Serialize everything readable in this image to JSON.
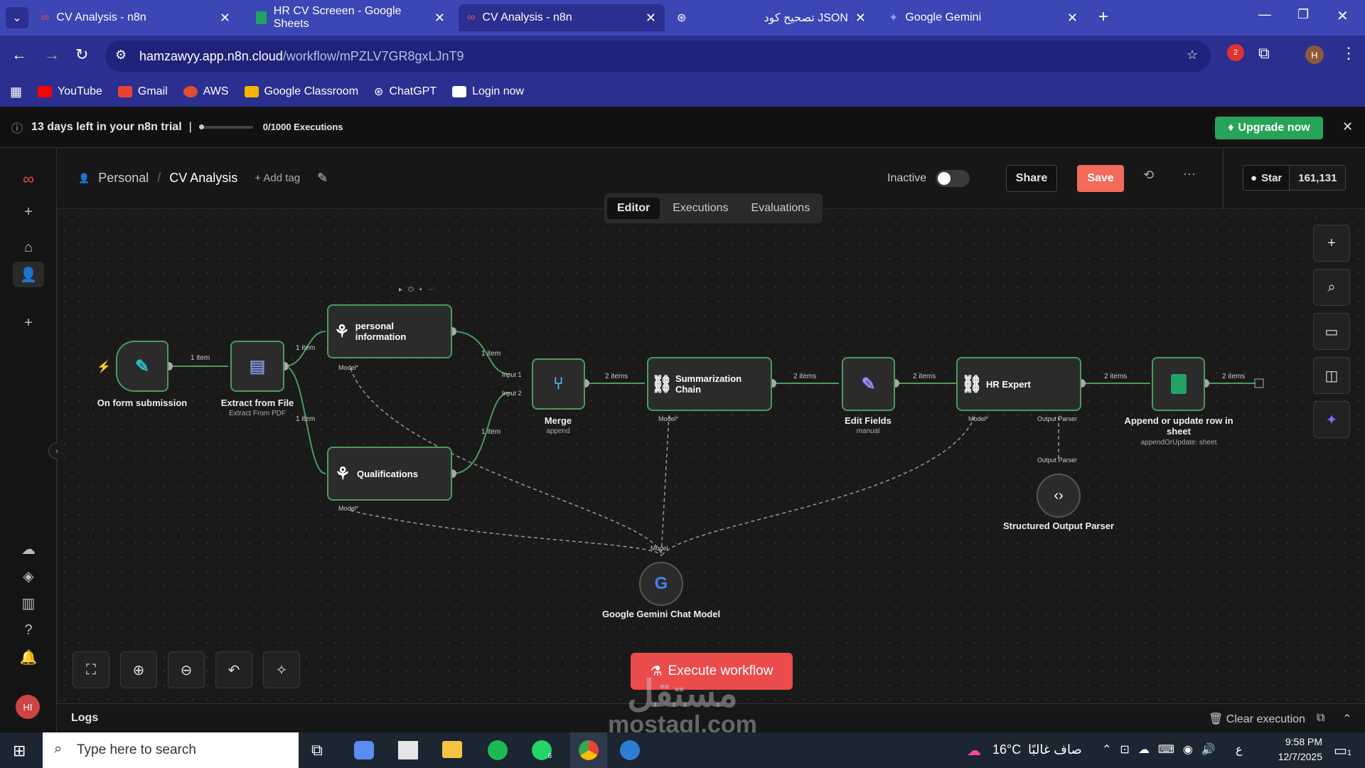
{
  "browser": {
    "tabs": [
      {
        "title": "CV Analysis - n8n"
      },
      {
        "title": "HR CV Screeen - Google Sheets"
      },
      {
        "title": "CV Analysis - n8n"
      },
      {
        "title": "تصحيح كود JSON"
      },
      {
        "title": "Google Gemini"
      }
    ],
    "url_host": "hamzawyy.app.n8n.cloud",
    "url_path": "/workflow/mPZLV7GR8gxLJnT9",
    "bookmarks": [
      "YouTube",
      "Gmail",
      "AWS",
      "Google Classroom",
      "ChatGPT",
      "Login now"
    ],
    "profile_initial": "H",
    "ext_badge": "2"
  },
  "trial": {
    "text": "13 days left in your n8n trial",
    "executions": "0/1000 Executions",
    "upgrade": "Upgrade now"
  },
  "header": {
    "breadcrumb_project": "Personal",
    "breadcrumb_sep": "/",
    "workflow_name": "CV Analysis",
    "add_tag": "+ Add tag",
    "status_label": "Inactive",
    "share": "Share",
    "save": "Save",
    "star": "Star",
    "star_count": "161,131",
    "tabs": [
      "Editor",
      "Executions",
      "Evaluations"
    ]
  },
  "nodes": {
    "form": {
      "label": "On form submission"
    },
    "extract": {
      "label": "Extract from File",
      "sub": "Extract From PDF"
    },
    "personal": {
      "label": "personal information"
    },
    "qual": {
      "label": "Qualifications"
    },
    "merge": {
      "label": "Merge",
      "sub": "append"
    },
    "summ": {
      "label": "Summarization Chain"
    },
    "edit": {
      "label": "Edit Fields",
      "sub": "manual"
    },
    "hr": {
      "label": "HR Expert"
    },
    "sheet": {
      "label": "Append or update row in sheet",
      "sub": "appendOrUpdate: sheet"
    },
    "parser": {
      "label": "Structured Output Parser"
    },
    "gemini": {
      "label": "Google Gemini Chat Model"
    }
  },
  "edges": {
    "one": "1 item",
    "two": "2 items",
    "input1": "Input 1",
    "input2": "Input 2",
    "model": "Model",
    "model_req": "Model*",
    "output_parser": "Output Parser"
  },
  "execute": "Execute workflow",
  "logs": {
    "title": "Logs",
    "clear": "Clear execution"
  },
  "taskbar": {
    "search": "Type here to search",
    "temp": "16°C",
    "weather": "صاف غالبًا",
    "time": "9:58 PM",
    "date": "12/7/2025",
    "lang": "ع",
    "whatsapp_badge": "6",
    "notif": "1"
  },
  "watermark": {
    "ar": "مستقل",
    "en": "mostaql.com"
  },
  "colors": {
    "accent": "#ea4b4b",
    "green": "#29a35a",
    "edge": "#4b9b5a"
  }
}
